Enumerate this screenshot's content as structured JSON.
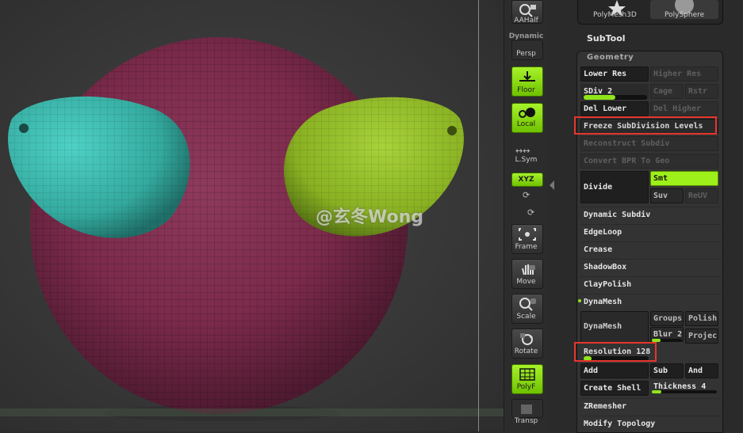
{
  "watermark": "@玄冬Wong",
  "shelf": {
    "aahalf": "AAHalf",
    "persp_top": "Dynamic",
    "persp": "Persp",
    "floor": "Floor",
    "local": "Local",
    "lsym": "L.Sym",
    "xyz": "XYZ",
    "frame": "Frame",
    "move": "Move",
    "scale": "Scale",
    "rotate": "Rotate",
    "polyf": "PolyF",
    "transp": "Transp"
  },
  "tool_thumbs": [
    "PolyMesh3D",
    "PolySphere"
  ],
  "subtool_label": "SubTool",
  "geometry": {
    "header": "Geometry",
    "lower_res": "Lower Res",
    "higher_res": "Higher Res",
    "sdiv": "SDiv 2",
    "sdiv_fraction": 0.5,
    "cage": "Cage",
    "rstr": "Rstr",
    "del_lower": "Del Lower",
    "del_higher": "Del Higher",
    "freeze": "Freeze SubDivision Levels",
    "reconstruct": "Reconstruct Subdiv",
    "convert_bpr": "Convert BPR To Geo",
    "divide": "Divide",
    "smt": "Smt",
    "suv": "Suv",
    "reuv": "ReUV",
    "sections": [
      "Dynamic Subdiv",
      "EdgeLoop",
      "Crease",
      "ShadowBox",
      "ClayPolish",
      "DynaMesh"
    ],
    "dynamesh_btn": "DynaMesh",
    "groups": "Groups",
    "polish": "Polish",
    "blur": "Blur 2",
    "projec": "Projec",
    "resolution": "Resolution 128",
    "resolution_fraction": 0.12,
    "add": "Add",
    "sub": "Sub",
    "and": "And",
    "create_shell": "Create Shell",
    "thickness": "Thickness 4",
    "zremesher": "ZRemesher",
    "modify_topology": "Modify Topology"
  },
  "colors": {
    "accent_green": "#9ef01a",
    "highlight_red": "#e8352b",
    "sphere": "#7a2a4a",
    "left_eye": "#3ab0a6",
    "right_eye": "#8fb526"
  }
}
